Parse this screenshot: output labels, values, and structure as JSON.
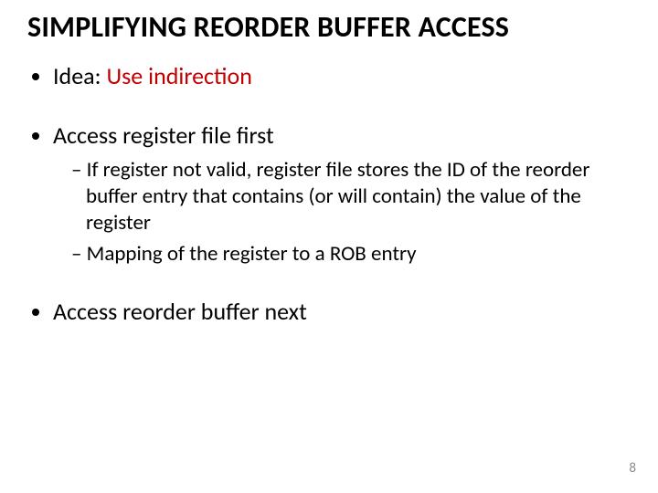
{
  "title": "SIMPLIFYING REORDER BUFFER ACCESS",
  "bullets": {
    "b1_prefix": "Idea: ",
    "b1_highlight": "Use indirection",
    "b2": "Access register file first",
    "b2_sub1": "If register not valid, register file stores the ID of the reorder buffer entry that contains (or will contain) the value of the register",
    "b2_sub2": "Mapping of the register to a ROB entry",
    "b3": "Access reorder buffer next"
  },
  "page_number": "8"
}
